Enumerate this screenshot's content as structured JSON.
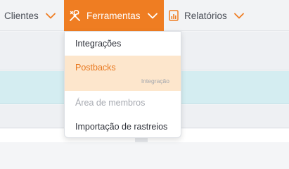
{
  "nav": {
    "clientes": "Clientes",
    "ferramentas": "Ferramentas",
    "relatorios": "Relatórios"
  },
  "dropdown": {
    "items": [
      {
        "label": "Integrações"
      },
      {
        "label": "Postbacks",
        "sublabel": "Integração"
      },
      {
        "label": "Área de membros",
        "disabled": true
      },
      {
        "label": "Importação de rastreios"
      }
    ]
  },
  "colors": {
    "accent": "#ef7d22",
    "highlight_bg": "#fde6cc",
    "selected_row": "#d4edf1"
  },
  "icons": {
    "ferramentas": "tools-icon",
    "relatorios": "report-chart-icon",
    "chevron": "chevron-down-icon"
  }
}
